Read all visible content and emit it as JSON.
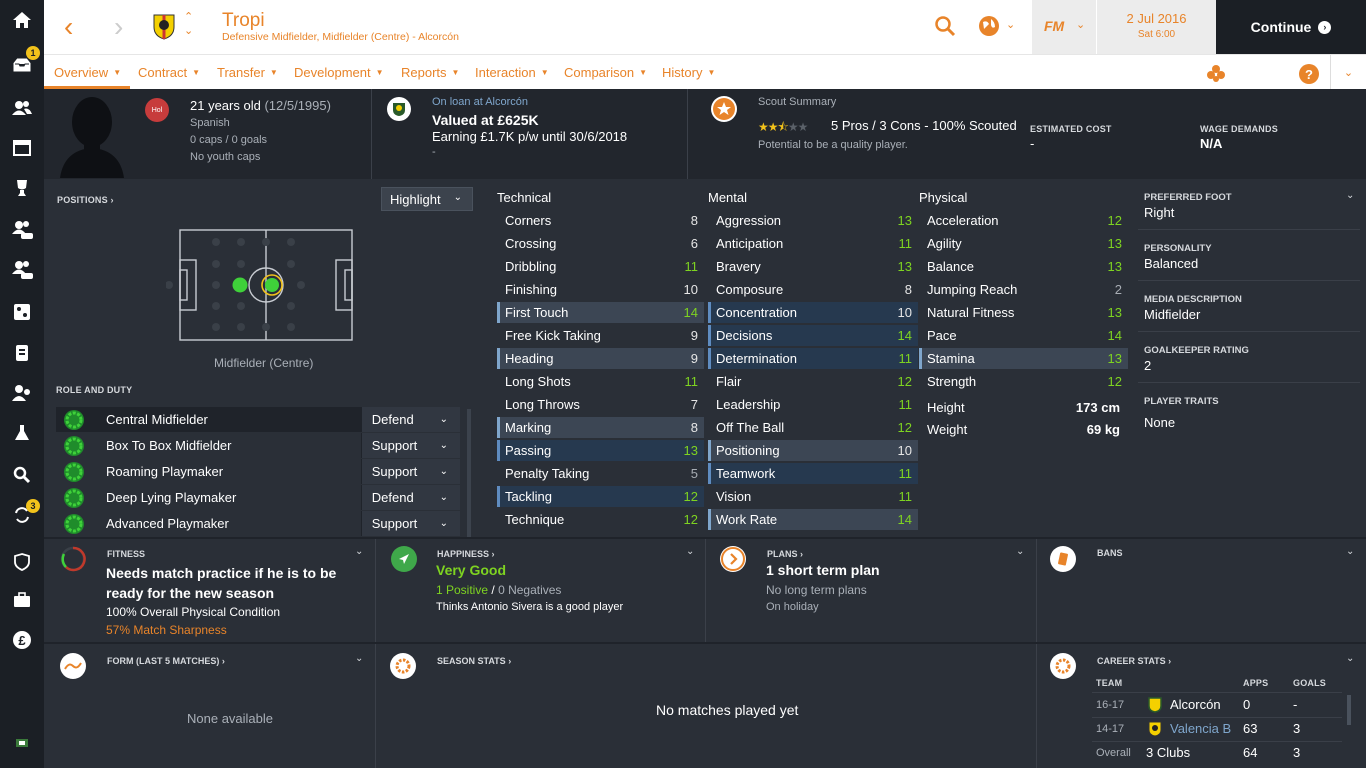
{
  "nav": {
    "inbox_badge": "1",
    "transfers_badge": "3"
  },
  "header": {
    "player_name": "Tropi",
    "player_subtitle": "Defensive Midfielder, Midfielder (Centre) - Alcorcón",
    "date": "2 Jul 2016",
    "time": "Sat 6:00",
    "continue_label": "Continue",
    "fm_logo": "FM"
  },
  "tabs": [
    {
      "label": "Overview"
    },
    {
      "label": "Contract"
    },
    {
      "label": "Transfer"
    },
    {
      "label": "Development"
    },
    {
      "label": "Reports"
    },
    {
      "label": "Interaction"
    },
    {
      "label": "Comparison"
    },
    {
      "label": "History"
    }
  ],
  "bio": {
    "age": "21 years old",
    "dob": "(12/5/1995)",
    "nationality": "Spanish",
    "caps": "0 caps / 0 goals",
    "youth_caps": "No youth caps",
    "flag_label": "Hol"
  },
  "contract": {
    "loan_status": "On loan at Alcorcón",
    "value": "Valued at £625K",
    "earning": "Earning £1.7K p/w until 30/6/2018",
    "extra": "-"
  },
  "scout": {
    "title": "Scout Summary",
    "summary": "5 Pros / 3 Cons - 100% Scouted",
    "potential": "Potential to be a quality player.",
    "stars": 2.5,
    "estimated_cost_label": "ESTIMATED COST",
    "estimated_cost": "-",
    "wage_label": "WAGE DEMANDS",
    "wage": "N/A"
  },
  "positions": {
    "title": "POSITIONS",
    "highlight_label": "Highlight",
    "position_label": "Midfielder (Centre)"
  },
  "roles": {
    "title": "ROLE AND DUTY",
    "items": [
      {
        "name": "Central Midfielder",
        "duty": "Defend"
      },
      {
        "name": "Box To Box Midfielder",
        "duty": "Support"
      },
      {
        "name": "Roaming Playmaker",
        "duty": "Support"
      },
      {
        "name": "Deep Lying Playmaker",
        "duty": "Defend"
      },
      {
        "name": "Advanced Playmaker",
        "duty": "Support"
      }
    ]
  },
  "attributes": {
    "technical_title": "Technical",
    "mental_title": "Mental",
    "physical_title": "Physical",
    "technical": [
      {
        "name": "Corners",
        "value": "8"
      },
      {
        "name": "Crossing",
        "value": "6"
      },
      {
        "name": "Dribbling",
        "value": "11"
      },
      {
        "name": "Finishing",
        "value": "10"
      },
      {
        "name": "First Touch",
        "value": "14"
      },
      {
        "name": "Free Kick Taking",
        "value": "9"
      },
      {
        "name": "Heading",
        "value": "9"
      },
      {
        "name": "Long Shots",
        "value": "11"
      },
      {
        "name": "Long Throws",
        "value": "7"
      },
      {
        "name": "Marking",
        "value": "8"
      },
      {
        "name": "Passing",
        "value": "13"
      },
      {
        "name": "Penalty Taking",
        "value": "5"
      },
      {
        "name": "Tackling",
        "value": "12"
      },
      {
        "name": "Technique",
        "value": "12"
      }
    ],
    "mental": [
      {
        "name": "Aggression",
        "value": "13"
      },
      {
        "name": "Anticipation",
        "value": "11"
      },
      {
        "name": "Bravery",
        "value": "13"
      },
      {
        "name": "Composure",
        "value": "8"
      },
      {
        "name": "Concentration",
        "value": "10"
      },
      {
        "name": "Decisions",
        "value": "14"
      },
      {
        "name": "Determination",
        "value": "11"
      },
      {
        "name": "Flair",
        "value": "12"
      },
      {
        "name": "Leadership",
        "value": "11"
      },
      {
        "name": "Off The Ball",
        "value": "12"
      },
      {
        "name": "Positioning",
        "value": "10"
      },
      {
        "name": "Teamwork",
        "value": "11"
      },
      {
        "name": "Vision",
        "value": "11"
      },
      {
        "name": "Work Rate",
        "value": "14"
      }
    ],
    "physical": [
      {
        "name": "Acceleration",
        "value": "12"
      },
      {
        "name": "Agility",
        "value": "13"
      },
      {
        "name": "Balance",
        "value": "13"
      },
      {
        "name": "Jumping Reach",
        "value": "2"
      },
      {
        "name": "Natural Fitness",
        "value": "13"
      },
      {
        "name": "Pace",
        "value": "14"
      },
      {
        "name": "Stamina",
        "value": "13"
      },
      {
        "name": "Strength",
        "value": "12"
      }
    ],
    "height_label": "Height",
    "height": "173 cm",
    "weight_label": "Weight",
    "weight": "69 kg"
  },
  "side": {
    "preferred_foot_label": "PREFERRED FOOT",
    "preferred_foot": "Right",
    "personality_label": "PERSONALITY",
    "personality": "Balanced",
    "media_label": "MEDIA DESCRIPTION",
    "media": "Midfielder",
    "gk_label": "GOALKEEPER RATING",
    "gk": "2",
    "traits_label": "PLAYER TRAITS",
    "traits": "None"
  },
  "fitness": {
    "title": "FITNESS",
    "headline": "Needs match practice if he is to be ready for the new season",
    "condition": "100% Overall Physical Condition",
    "sharpness": "57% Match Sharpness"
  },
  "happiness": {
    "title": "HAPPINESS",
    "status": "Very Good",
    "positives": "1 Positive",
    "separator": "/",
    "negatives": "0 Negatives",
    "note": "Thinks Antonio Sivera is a good player"
  },
  "plans": {
    "title": "PLANS",
    "headline": "1 short term plan",
    "long_term": "No long term plans",
    "holiday": "On holiday"
  },
  "bans": {
    "title": "BANS"
  },
  "form": {
    "title": "FORM (LAST 5 MATCHES)",
    "empty": "None available"
  },
  "season_stats": {
    "title": "SEASON STATS",
    "empty": "No matches played yet"
  },
  "career": {
    "title": "CAREER STATS",
    "headers": {
      "team": "TEAM",
      "apps": "APPS",
      "goals": "GOALS"
    },
    "rows": [
      {
        "season": "16-17",
        "team": "Alcorcón",
        "apps": "0",
        "goals": "-"
      },
      {
        "season": "14-17",
        "team": "Valencia B",
        "apps": "63",
        "goals": "3"
      },
      {
        "season": "Overall",
        "team": "3 Clubs",
        "apps": "64",
        "goals": "3"
      }
    ]
  },
  "colors": {
    "accent": "#e8842a",
    "attr_green": "#7ed321",
    "background": "#2a2f37",
    "nav": "#1b1f25"
  }
}
